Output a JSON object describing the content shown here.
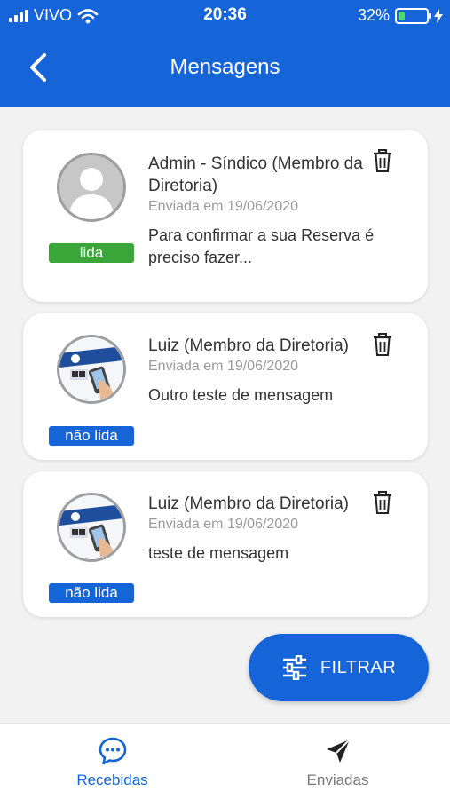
{
  "status_bar": {
    "carrier": "VIVO",
    "time": "20:36",
    "battery": "32%",
    "battery_level": 0.32
  },
  "header": {
    "title": "Mensagens"
  },
  "messages": [
    {
      "sender": "Admin - Síndico (Membro da Diretoria)",
      "date": "Enviada em 19/06/2020",
      "preview": "Para confirmar a sua Reserva é preciso fazer...",
      "status": "lida",
      "avatar": "default-user-avatar"
    },
    {
      "sender": "Luiz (Membro da Diretoria)",
      "date": "Enviada em 19/06/2020",
      "preview": "Outro teste de mensagem",
      "status": "não lida",
      "avatar": "promo-image-avatar"
    },
    {
      "sender": "Luiz (Membro da Diretoria)",
      "date": "Enviada em 19/06/2020",
      "preview": "teste de mensagem",
      "status": "não lida",
      "avatar": "promo-image-avatar"
    }
  ],
  "filter_button": {
    "label": "FILTRAR",
    "icon": "sliders-icon"
  },
  "tabbar": {
    "tabs": [
      {
        "label": "Recebidas",
        "icon": "chat-bubble-icon",
        "active": true
      },
      {
        "label": "Enviadas",
        "icon": "paper-plane-icon",
        "active": false
      }
    ]
  },
  "colors": {
    "primary": "#1565d8",
    "read_badge": "#3aa63a",
    "active_tab": "#1565d8",
    "inactive_tab": "#777777"
  }
}
